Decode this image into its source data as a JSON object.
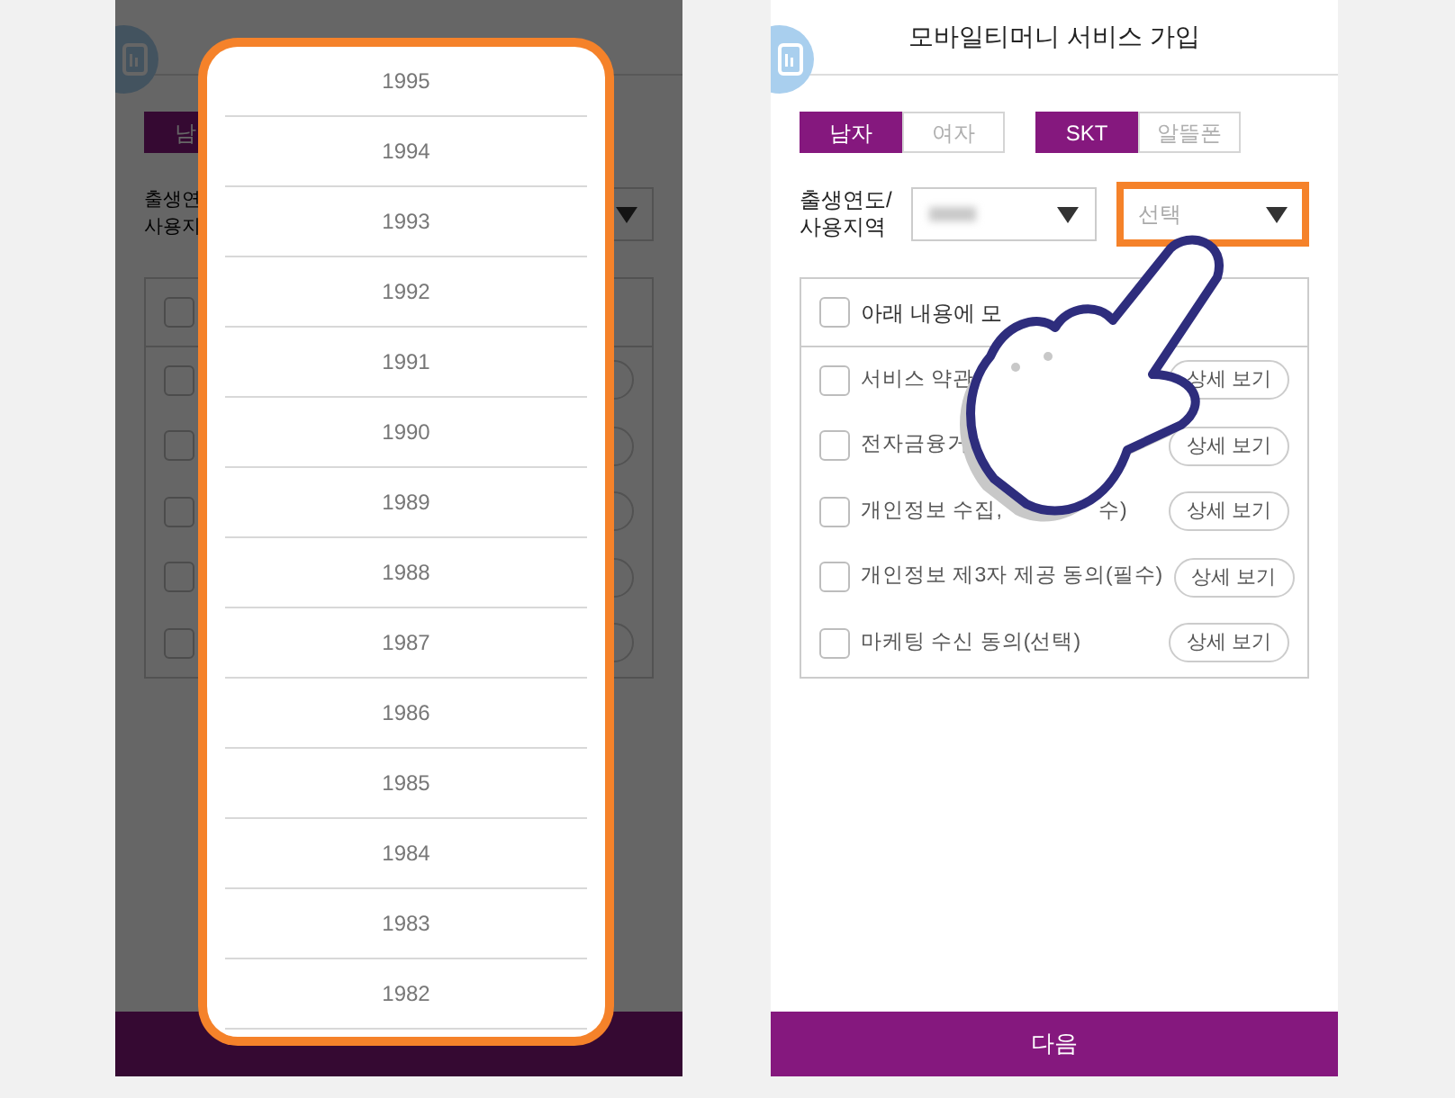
{
  "left_screen": {
    "gender_tab": {
      "label": "남",
      "selected": true
    },
    "field_label": [
      "출생연",
      "사용지"
    ],
    "checkboxes": [
      {
        "checked": false
      },
      {
        "checked": false
      },
      {
        "checked": false
      },
      {
        "checked": false
      },
      {
        "checked": false
      },
      {
        "checked": false
      }
    ],
    "year_picker": {
      "highlighted": true,
      "options": [
        "1995",
        "1994",
        "1993",
        "1992",
        "1991",
        "1990",
        "1989",
        "1988",
        "1987",
        "1986",
        "1985",
        "1984",
        "1983",
        "1982"
      ]
    }
  },
  "right_screen": {
    "title": "모바일티머니 서비스 가입",
    "gender_tabs": [
      {
        "label": "남자",
        "selected": true
      },
      {
        "label": "여자",
        "selected": false
      }
    ],
    "carrier_tabs": [
      {
        "label": "SKT",
        "selected": true
      },
      {
        "label": "알뜰폰",
        "selected": false
      }
    ],
    "field_label": [
      "출생연도/",
      "사용지역"
    ],
    "region_select": {
      "value": "선택",
      "highlighted": true
    },
    "agree_all": {
      "label": "아래 내용에 모",
      "checked": false
    },
    "agreements": [
      {
        "label": "서비스 약관",
        "checked": false,
        "detail": "상세 보기"
      },
      {
        "label": "전자금융거",
        "checked": false,
        "detail": "상세 보기"
      },
      {
        "label": "개인정보 수집,",
        "tail": "수)",
        "checked": false,
        "detail": "상세 보기"
      },
      {
        "label": "개인정보 제3자 제공 동의(필수)",
        "checked": false,
        "detail": "상세 보기"
      },
      {
        "label": "마케팅 수신 동의(선택)",
        "checked": false,
        "detail": "상세 보기"
      }
    ],
    "next_button": "다음"
  }
}
